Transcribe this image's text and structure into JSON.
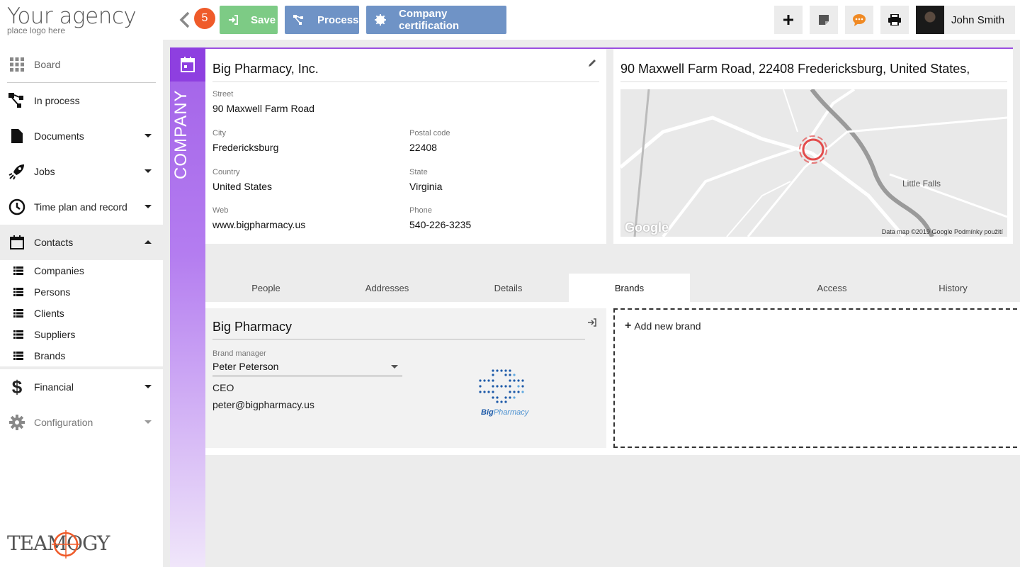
{
  "logo": {
    "line1": "Your agency",
    "line2": "place logo here"
  },
  "sidebar": {
    "items": [
      {
        "label": "Board"
      },
      {
        "label": "In process"
      },
      {
        "label": "Documents"
      },
      {
        "label": "Jobs"
      },
      {
        "label": "Time plan and record"
      },
      {
        "label": "Contacts"
      },
      {
        "label": "Financial"
      },
      {
        "label": "Configuration"
      }
    ],
    "contacts_sub": [
      {
        "label": "Companies"
      },
      {
        "label": "Persons"
      },
      {
        "label": "Clients"
      },
      {
        "label": "Suppliers"
      },
      {
        "label": "Brands"
      }
    ],
    "footer_brand": "TEAMOGY"
  },
  "topbar": {
    "notification_count": "5",
    "save_label": "Save",
    "process_label": "Process",
    "certification_label": "Company certification",
    "user_name": "John Smith",
    "colors": {
      "save": "#7dcb85",
      "action": "#6f93c6",
      "badge": "#ef5b2a"
    }
  },
  "company": {
    "strip_label": "COMPANY",
    "name": "Big Pharmacy, Inc.",
    "fields": {
      "street": {
        "label": "Street",
        "value": "90  Maxwell Farm Road"
      },
      "city": {
        "label": "City",
        "value": "Fredericksburg"
      },
      "postal": {
        "label": "Postal code",
        "value": "22408"
      },
      "country": {
        "label": "Country",
        "value": "United States"
      },
      "state": {
        "label": "State",
        "value": "Virginia"
      },
      "web": {
        "label": "Web",
        "value": "www.bigpharmacy.us"
      },
      "phone": {
        "label": "Phone",
        "value": "540-226-3235"
      }
    }
  },
  "map": {
    "address": "90 Maxwell Farm Road, 22408 Fredericksburg, United States,",
    "town_label": "Little Falls",
    "google": "Google",
    "attribution": "Data map ©2019 Google   Podmínky použití"
  },
  "tabs": [
    {
      "label": "People"
    },
    {
      "label": "Addresses"
    },
    {
      "label": "Details"
    },
    {
      "label": "Brands"
    },
    {
      "label": ""
    },
    {
      "label": "Access"
    },
    {
      "label": "History"
    }
  ],
  "active_tab": "Brands",
  "brand": {
    "name": "Big Pharmacy",
    "manager_label": "Brand manager",
    "manager_value": "Peter Peterson",
    "role": "CEO",
    "email": "peter@bigpharmacy.us",
    "logo_text_bold": "Big",
    "logo_text_light": "Pharmacy"
  },
  "add_brand_label": "Add new brand"
}
